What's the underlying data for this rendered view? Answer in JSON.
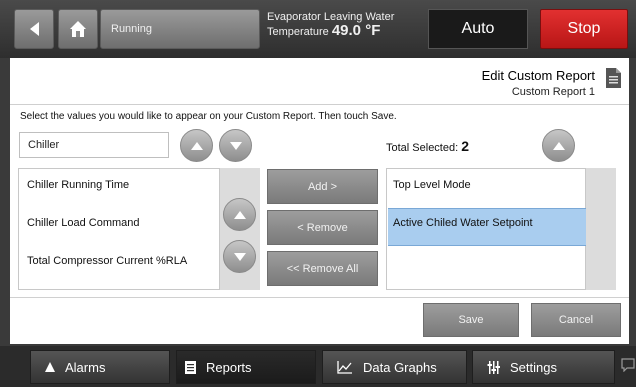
{
  "topbar": {
    "status": "Running",
    "evap_label": "Evaporator Leaving Water",
    "evap_temp_label": "Temperature",
    "evap_value": "49.0 °F",
    "auto": "Auto",
    "stop": "Stop"
  },
  "page": {
    "title": "Edit Custom Report",
    "subtitle": "Custom Report 1",
    "instructions": "Select the values you would like to appear on your Custom Report. Then touch Save."
  },
  "filter": {
    "value": "Chiller"
  },
  "total": {
    "label": "Total Selected:",
    "count": "2"
  },
  "available": [
    "Chiller Running Time",
    "Chiller Load Command",
    "Total Compressor Current %RLA"
  ],
  "selected": [
    "Top Level Mode",
    "Active Chiled Water Setpoint"
  ],
  "actions": {
    "add": "Add >",
    "remove": "< Remove",
    "remove_all": "<< Remove All"
  },
  "footer": {
    "save": "Save",
    "cancel": "Cancel"
  },
  "nav": {
    "alarms": "Alarms",
    "reports": "Reports",
    "data_graphs": "Data Graphs",
    "settings": "Settings"
  },
  "icons": [
    "back-arrow-icon",
    "home-icon",
    "document-icon",
    "chevron-up-icon",
    "chevron-down-icon",
    "alarm-icon",
    "report-icon",
    "chart-icon",
    "settings-icon",
    "chat-icon"
  ],
  "colors": {
    "stop": "#d62424",
    "selection": "#a9cdef"
  }
}
